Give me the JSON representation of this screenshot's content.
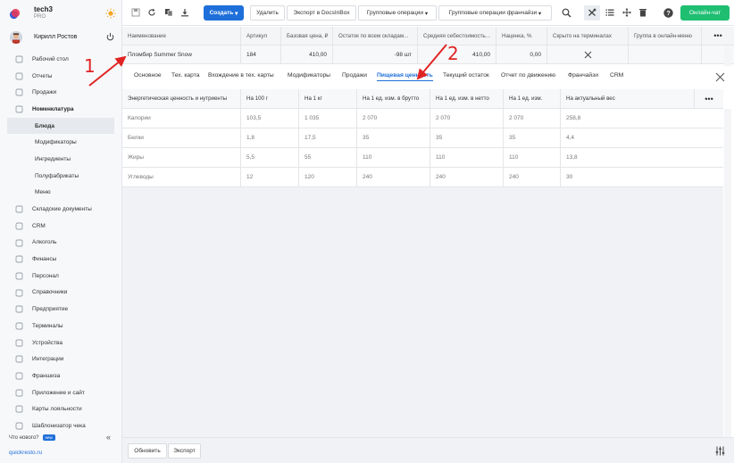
{
  "brand": {
    "name": "tech3",
    "plan": "PRO"
  },
  "user": {
    "name": "Кирилл Ростов"
  },
  "sidebar": {
    "items": [
      {
        "label": "Рабочий стол",
        "icon": "dashboard-icon"
      },
      {
        "label": "Отчеты",
        "icon": "reports-icon"
      },
      {
        "label": "Продажи",
        "icon": "sales-icon"
      },
      {
        "label": "Номенклатура",
        "icon": "tag-icon",
        "bold": true
      },
      {
        "label": "Блюда",
        "sub": true,
        "active": true
      },
      {
        "label": "Модификаторы",
        "sub": true
      },
      {
        "label": "Ингредиенты",
        "sub": true
      },
      {
        "label": "Полуфабрикаты",
        "sub": true
      },
      {
        "label": "Меню",
        "sub": true
      },
      {
        "label": "Складские документы",
        "icon": "warehouse-icon"
      },
      {
        "label": "CRM",
        "icon": "crm-icon"
      },
      {
        "label": "Алкоголь",
        "icon": "wine-icon"
      },
      {
        "label": "Финансы",
        "icon": "finance-icon"
      },
      {
        "label": "Персонал",
        "icon": "staff-icon"
      },
      {
        "label": "Справочники",
        "icon": "book-icon"
      },
      {
        "label": "Предприятие",
        "icon": "company-icon"
      },
      {
        "label": "Терминалы",
        "icon": "terminal-icon"
      },
      {
        "label": "Устройства",
        "icon": "device-icon"
      },
      {
        "label": "Интеграции",
        "icon": "integration-icon"
      },
      {
        "label": "Франшиза",
        "icon": "franchise-icon"
      },
      {
        "label": "Приложение и сайт",
        "icon": "app-icon"
      },
      {
        "label": "Карты лояльности",
        "icon": "card-icon"
      },
      {
        "label": "Шаблонизатор чека",
        "icon": "receipt-icon"
      }
    ],
    "whats_new": "Что нового?",
    "new_badge": "new",
    "footer_link": "quickresto.ru"
  },
  "toolbar": {
    "create": "Создать",
    "delete": "Удалить",
    "export_docsinbox": "Экспорт в DocsInBox",
    "group_ops": "Групповые операции",
    "group_ops_franchise": "Групповые операции франчайзи",
    "online_chat": "Онлайн-чат"
  },
  "main_table": {
    "headers": [
      "Наименование",
      "Артикул",
      "Базовая цена, ₽",
      "Остаток по всем складам...",
      "Средняя себестоимость...",
      "Наценка, %",
      "Скрыто на терминалах",
      "Группа в онлайн-меню"
    ],
    "row": [
      "Пломбир Summer Snow",
      "184",
      "410,00",
      "-98 шт",
      "410,00",
      "0,00",
      "",
      ""
    ]
  },
  "tabs": [
    "Основное",
    "Тех. карта",
    "Вхождение в тех. карты",
    "Модификаторы",
    "Продажи",
    "Пищевая ценность",
    "Текущий остаток",
    "Отчет по движению",
    "Франчайзи",
    "CRM"
  ],
  "active_tab": "Пищевая ценность",
  "nutrition": {
    "headers": [
      "Энергетическая ценность и нутриенты",
      "На 100 г",
      "На 1 кг",
      "На 1 ед. изм. в брутто",
      "На 1 ед. изм. в нетто",
      "На 1 ед. изм.",
      "На актуальный вес"
    ],
    "rows": [
      [
        "Калории",
        "103,5",
        "1 035",
        "2 070",
        "2 070",
        "2 070",
        "258,8"
      ],
      [
        "Белки",
        "1,8",
        "17,5",
        "35",
        "35",
        "35",
        "4,4"
      ],
      [
        "Жиры",
        "5,5",
        "55",
        "110",
        "110",
        "110",
        "13,8"
      ],
      [
        "Углеводы",
        "12",
        "120",
        "240",
        "240",
        "240",
        "30"
      ]
    ]
  },
  "bottombar": {
    "refresh": "Обновить",
    "export": "Экспорт"
  },
  "annotations": {
    "one": "1",
    "two": "2",
    "color": "#e02424"
  },
  "colors": {
    "accent": "#1e6fd9",
    "online": "#1fbf72"
  }
}
